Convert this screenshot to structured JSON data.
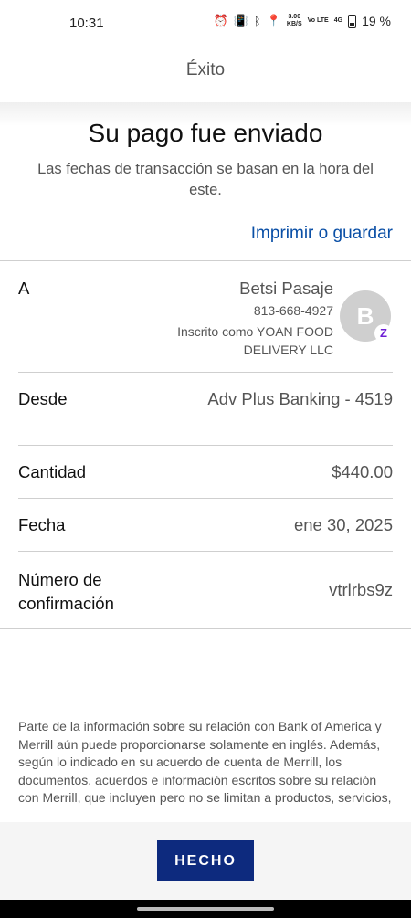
{
  "status_bar": {
    "time": "10:31",
    "net_speed_value": "3.00",
    "net_speed_unit": "KB/S",
    "volte": "Vo LTE",
    "signal": "4G",
    "battery": "19 %"
  },
  "nav": {
    "title": "Éxito"
  },
  "confirmation": {
    "headline": "Su pago fue enviado",
    "subhead": "Las fechas de transacción se basan en la hora del este.",
    "print_link": "Imprimir o guardar"
  },
  "details": {
    "to": {
      "label": "A",
      "name": "Betsi Pasaje",
      "phone": "813-668-4927",
      "enrolled": "Inscrito como YOAN FOOD DELIVERY LLC",
      "avatar_letter": "B",
      "badge_glyph": "Z"
    },
    "from": {
      "label": "Desde",
      "value": "Adv Plus Banking - 4519"
    },
    "amount": {
      "label": "Cantidad",
      "value": "$440.00"
    },
    "date": {
      "label": "Fecha",
      "value": "ene 30, 2025"
    },
    "confirmation_number": {
      "label": "Número de confirmación",
      "value": "vtrlrbs9z"
    }
  },
  "disclaimer": "Parte de la información sobre su relación con Bank of America y Merrill aún puede proporcionarse solamente en inglés. Además, según lo indicado en su acuerdo de cuenta de Merrill, los documentos, acuerdos e información escritos sobre su relación con Merrill, que incluyen pero no se limitan a productos, servicios,",
  "footer": {
    "done_label": "HECHO"
  },
  "colors": {
    "link": "#0a4fa6",
    "primary_button": "#0d2a7e",
    "zelle": "#6d1ed4"
  }
}
